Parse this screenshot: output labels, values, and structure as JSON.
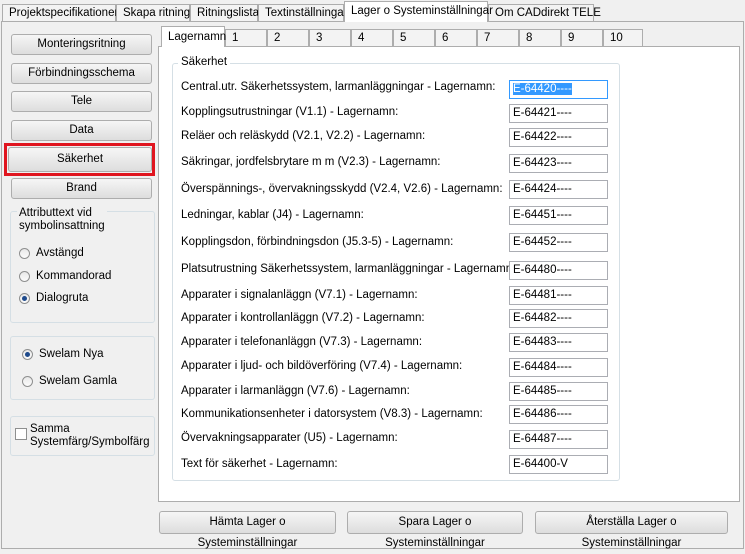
{
  "top_tabs": [
    {
      "label": "Projektspecifikationer"
    },
    {
      "label": "Skapa ritning"
    },
    {
      "label": "Ritningslista"
    },
    {
      "label": "Textinställningar"
    },
    {
      "label": "Lager o Systeminställningar",
      "active": true
    },
    {
      "label": "Om CADdirekt TELE"
    }
  ],
  "sidebar": {
    "buttons": [
      {
        "label": "Monteringsritning"
      },
      {
        "label": "Förbindningsschema"
      },
      {
        "label": "Tele"
      },
      {
        "label": "Data"
      },
      {
        "label": "Säkerhet",
        "highlighted": true
      },
      {
        "label": "Brand"
      }
    ],
    "attribute_group": {
      "title_line1": "Attributtext vid",
      "title_line2": "symbolinsattning",
      "options": [
        {
          "label": "Avstängd",
          "selected": false
        },
        {
          "label": "Kommandorad",
          "selected": false
        },
        {
          "label": "Dialogruta",
          "selected": true
        }
      ]
    },
    "swelam_group": {
      "options": [
        {
          "label": "Swelam Nya",
          "selected": true
        },
        {
          "label": "Swelam Gamla",
          "selected": false
        }
      ]
    },
    "checkbox": {
      "line1": "Samma",
      "line2": "Systemfärg/Symbolfärg",
      "checked": false
    }
  },
  "inner_tabs": [
    "Lagernamn",
    "1",
    "2",
    "3",
    "4",
    "5",
    "6",
    "7",
    "8",
    "9",
    "10"
  ],
  "section_title": "Säkerhet",
  "rows": [
    {
      "label": "Central.utr. Säkerhetssystem, larmanläggningar - Lagernamn:",
      "value": "E-64420----"
    },
    {
      "label": "Kopplingsutrustningar (V1.1) - Lagernamn:",
      "value": "E-64421----"
    },
    {
      "label": "Reläer och reläskydd (V2.1, V2.2) - Lagernamn:",
      "value": "E-64422----"
    },
    {
      "label": "Säkringar, jordfelsbrytare m m (V2.3) - Lagernamn:",
      "value": "E-64423----"
    },
    {
      "label": "Överspännings-, övervakningsskydd (V2.4, V2.6) - Lagernamn:",
      "value": "E-64424----"
    },
    {
      "label": "Ledningar, kablar (J4) - Lagernamn:",
      "value": "E-64451----"
    },
    {
      "label": "Kopplingsdon, förbindningsdon (J5.3-5) - Lagernamn:",
      "value": "E-64452----"
    },
    {
      "label": "Platsutrustning Säkerhetssystem, larmanläggningar - Lagernamn:",
      "value": "E-64480----"
    },
    {
      "label": "Apparater i signalanläggn (V7.1) - Lagernamn:",
      "value": "E-64481----"
    },
    {
      "label": "Apparater i kontrollanläggn (V7.2) - Lagernamn:",
      "value": "E-64482----"
    },
    {
      "label": "Apparater i telefonanläggn (V7.3) - Lagernamn:",
      "value": "E-64483----"
    },
    {
      "label": "Apparater i ljud- och bildöverföring (V7.4) - Lagernamn:",
      "value": "E-64484----"
    },
    {
      "label": "Apparater i larmanläggn (V7.6) - Lagernamn:",
      "value": "E-64485----"
    },
    {
      "label": "Kommunikationsenheter i datorsystem (V8.3) - Lagernamn:",
      "value": "E-64486----"
    },
    {
      "label": "Övervakningsapparater (U5) - Lagernamn:",
      "value": "E-64487----"
    },
    {
      "label": "Text för säkerhet - Lagernamn:",
      "value": "E-64400-V"
    }
  ],
  "footer_buttons": {
    "fetch": "Hämta Lager o Systeminställningar",
    "save": "Spara Lager o Systeminställningar",
    "restore": "Återställa Lager o Systeminställningar"
  },
  "colors": {
    "highlight": "#e0151f",
    "focus": "#3399ff"
  }
}
